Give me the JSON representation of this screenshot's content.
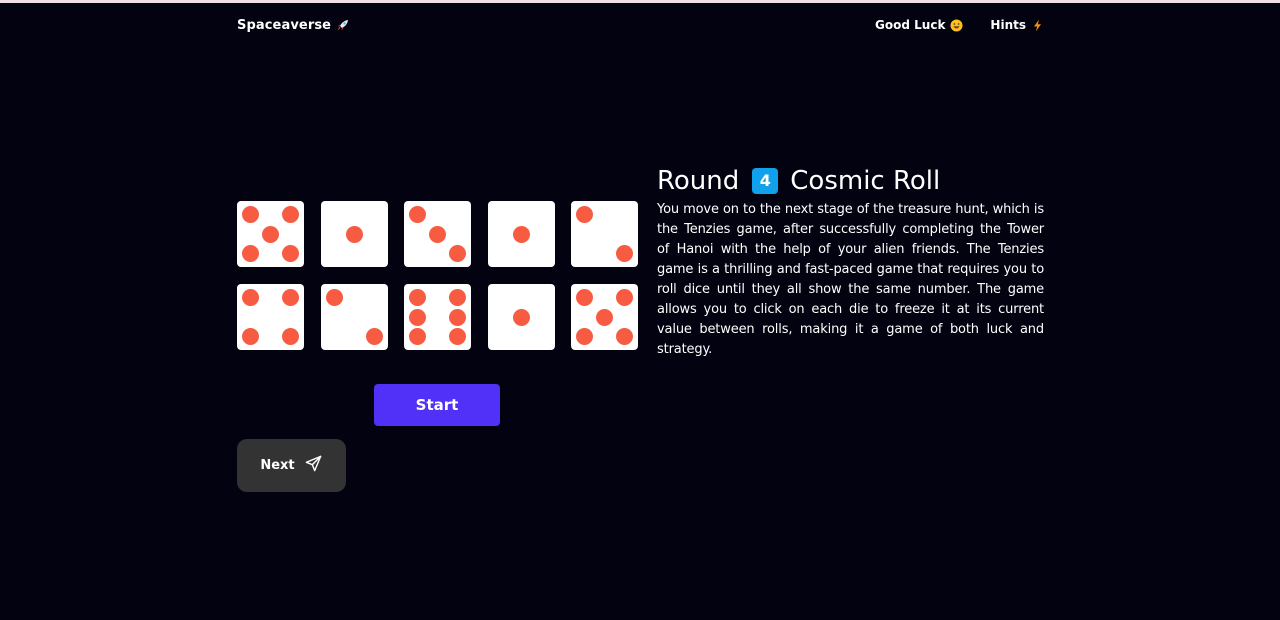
{
  "navbar": {
    "brand": "Spaceaverse",
    "brand_icon": "rocket-icon",
    "links": [
      {
        "label": "Good Luck",
        "icon": "grinning-face-icon"
      },
      {
        "label": "Hints",
        "icon": "lightning-icon"
      }
    ]
  },
  "game": {
    "round_label": "Round",
    "round_number": "4",
    "round_name": "Cosmic Roll",
    "description": "You move on to the next stage of the treasure hunt, which is the Tenzies game, after successfully completing the Tower of Hanoi with the help of your alien friends. The Tenzies game is a thrilling and fast-paced game that requires you to roll dice until they all show the same number. The game allows you to click on each die to freeze it at its current value between rolls, making it a game of both luck and strategy.",
    "dice": [
      5,
      1,
      3,
      1,
      2,
      4,
      2,
      6,
      1,
      5
    ],
    "start_label": "Start",
    "next_label": "Next",
    "next_icon": "send-icon"
  },
  "colors": {
    "background": "#020210",
    "pip": "#f75c43",
    "start_button": "#5131f8",
    "next_button": "#333333",
    "round_badge": "#10a0ec"
  }
}
